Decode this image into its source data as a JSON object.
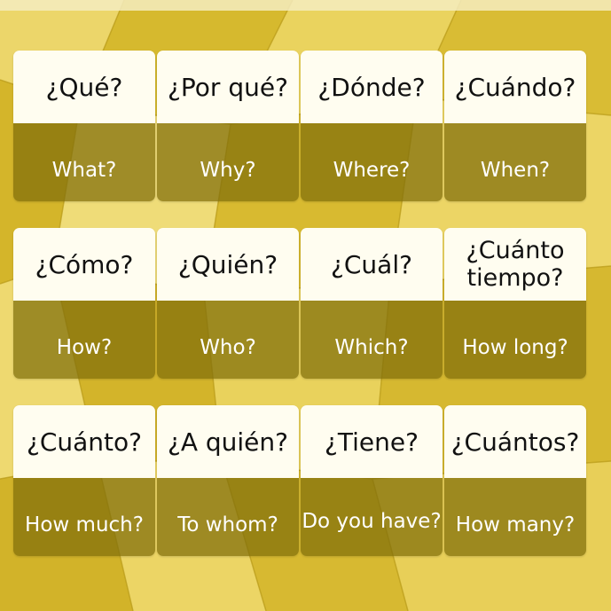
{
  "cards": [
    {
      "spanish": "¿Qué?",
      "english": "What?"
    },
    {
      "spanish": "¿Por qué?",
      "english": "Why?"
    },
    {
      "spanish": "¿Dónde?",
      "english": "Where?"
    },
    {
      "spanish": "¿Cuándo?",
      "english": "When?"
    },
    {
      "spanish": "¿Cómo?",
      "english": "How?"
    },
    {
      "spanish": "¿Quién?",
      "english": "Who?"
    },
    {
      "spanish": "¿Cuál?",
      "english": "Which?"
    },
    {
      "spanish": "¿Cuánto tiempo?",
      "english": "How long?"
    },
    {
      "spanish": "¿Cuánto?",
      "english": "How much?"
    },
    {
      "spanish": "¿A quién?",
      "english": "To whom?"
    },
    {
      "spanish": "¿Tiene?",
      "english": "Do you have?"
    },
    {
      "spanish": "¿Cuántos?",
      "english": "How many?"
    }
  ],
  "colors": {
    "background": "#e2c640",
    "card_top": "#fffdf0",
    "card_bottom": "#80700a",
    "text_dark": "#111111",
    "text_light": "#ffffff"
  }
}
